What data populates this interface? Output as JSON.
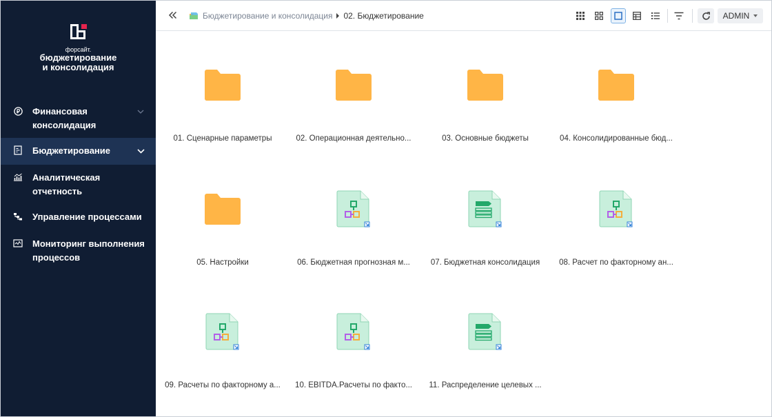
{
  "sidebar": {
    "logo_small": "форсайт.",
    "logo_line1": "бюджетирование",
    "logo_line2": "и консолидация",
    "items": [
      {
        "label_line1": "Финансовая",
        "label_line2": "консолидация",
        "icon": "ruble-icon"
      },
      {
        "label_line1": "Бюджетирование",
        "label_line2": "",
        "icon": "budget-icon"
      },
      {
        "label_line1": "Аналитическая",
        "label_line2": "отчетность",
        "icon": "analytics-icon"
      },
      {
        "label_line1": "Управление процессами",
        "label_line2": "",
        "icon": "process-icon"
      },
      {
        "label_line1": "Мониторинг выполнения",
        "label_line2": "процессов",
        "icon": "monitor-icon"
      }
    ]
  },
  "header": {
    "breadcrumb_root": "Бюджетирование и консолидация",
    "breadcrumb_current": "02. Бюджетирование",
    "user": "ADMIN"
  },
  "items": [
    {
      "label": "01. Сценарные параметры",
      "type": "folder"
    },
    {
      "label": "02. Операционная деятельно...",
      "type": "folder"
    },
    {
      "label": "03. Основные бюджеты",
      "type": "folder"
    },
    {
      "label": "04. Консолидированные бюд...",
      "type": "folder"
    },
    {
      "label": "05. Настройки",
      "type": "folder"
    },
    {
      "label": "06. Бюджетная прогнозная м...",
      "type": "model"
    },
    {
      "label": "07. Бюджетная консолидация",
      "type": "form"
    },
    {
      "label": "08. Расчет по факторному ан...",
      "type": "model"
    },
    {
      "label": "09. Расчеты по факторному а...",
      "type": "model"
    },
    {
      "label": "10. EBITDA.Расчеты по факто...",
      "type": "model"
    },
    {
      "label": "11. Распределение целевых ...",
      "type": "form"
    }
  ],
  "colors": {
    "sidebar_bg": "#101d33",
    "sidebar_active": "#1e3354",
    "folder": "#ffb546",
    "doc_fill": "#c8efdc",
    "doc_green": "#23a86a",
    "doc_purple": "#b35fe8",
    "doc_orange": "#f4ad3d",
    "shortcut_blue": "#2f7fd8"
  }
}
